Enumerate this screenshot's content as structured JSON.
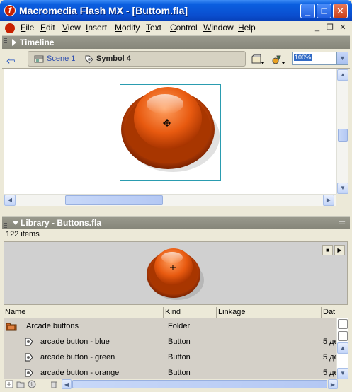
{
  "window": {
    "title": "Macromedia Flash MX - [Buttom.fla]",
    "minimize": "_",
    "maximize": "□",
    "close": "✕"
  },
  "menu": {
    "items": [
      {
        "label": "File",
        "key": "F",
        "rest": "ile"
      },
      {
        "label": "Edit",
        "key": "E",
        "rest": "dit"
      },
      {
        "label": "View",
        "key": "V",
        "rest": "iew"
      },
      {
        "label": "Insert",
        "key": "I",
        "rest": "nsert"
      },
      {
        "label": "Modify",
        "key": "M",
        "rest": "odify"
      },
      {
        "label": "Text",
        "key": "T",
        "rest": "ext"
      },
      {
        "label": "Control",
        "key": "C",
        "rest": "ontrol"
      },
      {
        "label": "Window",
        "key": "W",
        "rest": "indow"
      },
      {
        "label": "Help",
        "key": "H",
        "rest": "elp"
      }
    ]
  },
  "timeline": {
    "label": "Timeline"
  },
  "editbar": {
    "scene_label": "Scene 1",
    "symbol_label": "Symbol 4",
    "zoom": "100%"
  },
  "library": {
    "title": "Library - Buttons.fla",
    "count": "122 items",
    "columns": [
      "Name",
      "Kind",
      "Linkage",
      "Dat"
    ],
    "rows": [
      {
        "name": "Arcade buttons",
        "kind": "Folder",
        "linkage": "",
        "date": "",
        "type": "folder"
      },
      {
        "name": "arcade button - blue",
        "kind": "Button",
        "linkage": "",
        "date": "5 де",
        "type": "button"
      },
      {
        "name": "arcade button - green",
        "kind": "Button",
        "linkage": "",
        "date": "5 де",
        "type": "button"
      },
      {
        "name": "arcade button - orange",
        "kind": "Button",
        "linkage": "",
        "date": "5 де",
        "type": "button"
      }
    ]
  },
  "colors": {
    "accent": "#0a4fd0",
    "button_orange": "#e05a10"
  }
}
